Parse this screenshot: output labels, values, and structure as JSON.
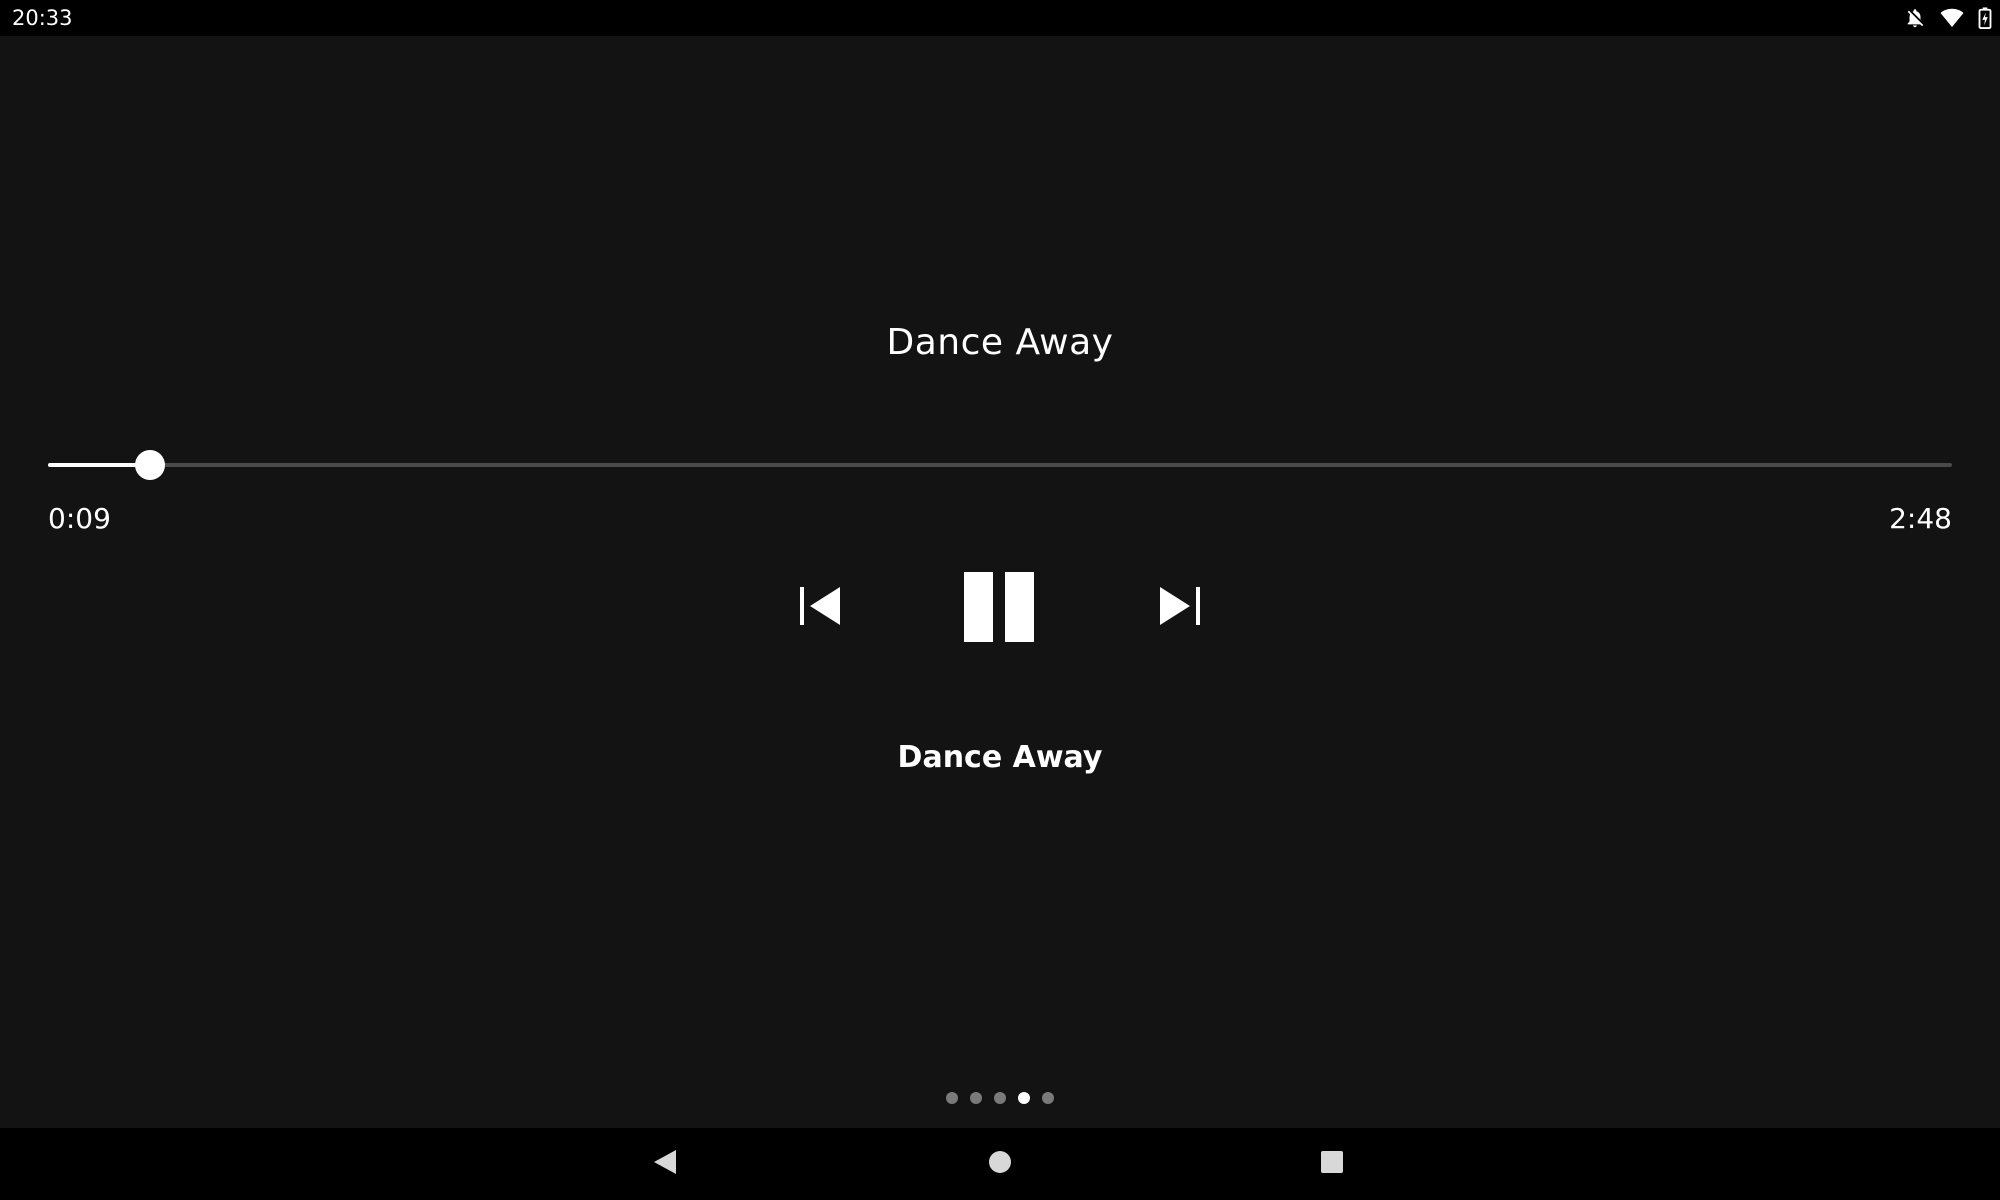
{
  "status_bar": {
    "time": "20:33",
    "icons": [
      "notifications-off-icon",
      "wifi-icon",
      "battery-charging-icon"
    ]
  },
  "player": {
    "title": "Dance Away",
    "artist": "Dance Away",
    "elapsed": "0:09",
    "duration": "2:48",
    "progress_fraction": 0.0536,
    "state": "playing",
    "controls": [
      "skip-previous-icon",
      "pause-icon",
      "skip-next-icon"
    ]
  },
  "pager": {
    "count": 5,
    "active_index": 3
  },
  "nav_bar": {
    "buttons": [
      "back-icon",
      "home-icon",
      "recents-icon"
    ]
  },
  "colors": {
    "background": "#131313",
    "bars": "#000000",
    "accent": "#ffffff",
    "track": "#4a4a4a",
    "inactive_dot": "#7a7a7a"
  }
}
